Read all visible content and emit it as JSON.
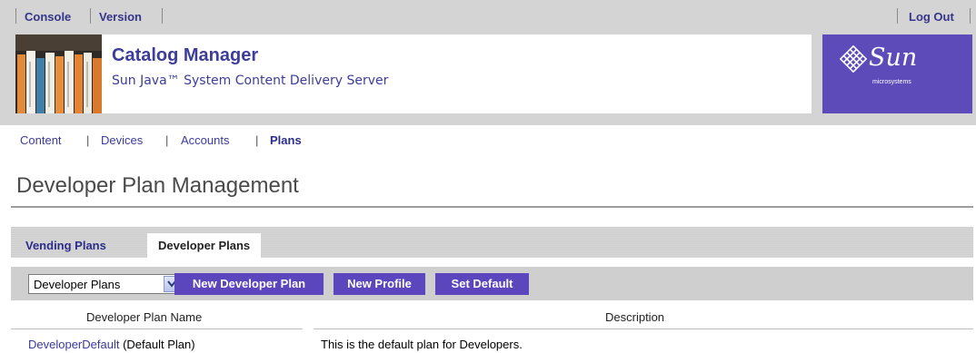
{
  "topbar": {
    "console_label": "Console",
    "version_label": "Version",
    "logout_label": "Log Out"
  },
  "banner": {
    "title": "Catalog Manager",
    "subtitle": "Sun Java™ System Content Delivery Server"
  },
  "logo": {
    "word": "Sun",
    "sub": "microsystems"
  },
  "nav": {
    "items": [
      "Content",
      "Devices",
      "Accounts",
      "Plans"
    ],
    "separator": "|",
    "active": "Plans"
  },
  "page_title": "Developer Plan Management",
  "tabs": [
    {
      "label": "Vending Plans",
      "active": false
    },
    {
      "label": "Developer Plans",
      "active": true
    }
  ],
  "toolbar": {
    "select_value": "Developer Plans",
    "new_plan_label": "New Developer Plan",
    "new_profile_label": "New Profile",
    "set_default_label": "Set Default"
  },
  "table": {
    "columns": [
      "Developer Plan Name",
      "Description"
    ],
    "rows": [
      {
        "name": "DeveloperDefault",
        "name_suffix": " (Default Plan)",
        "description": "This is the default plan for Developers."
      }
    ]
  },
  "colors": {
    "accent": "#5c46be",
    "link": "#3b3b9c",
    "masthead": "#d4d4d4",
    "logo_bg": "#5c4bb8"
  }
}
